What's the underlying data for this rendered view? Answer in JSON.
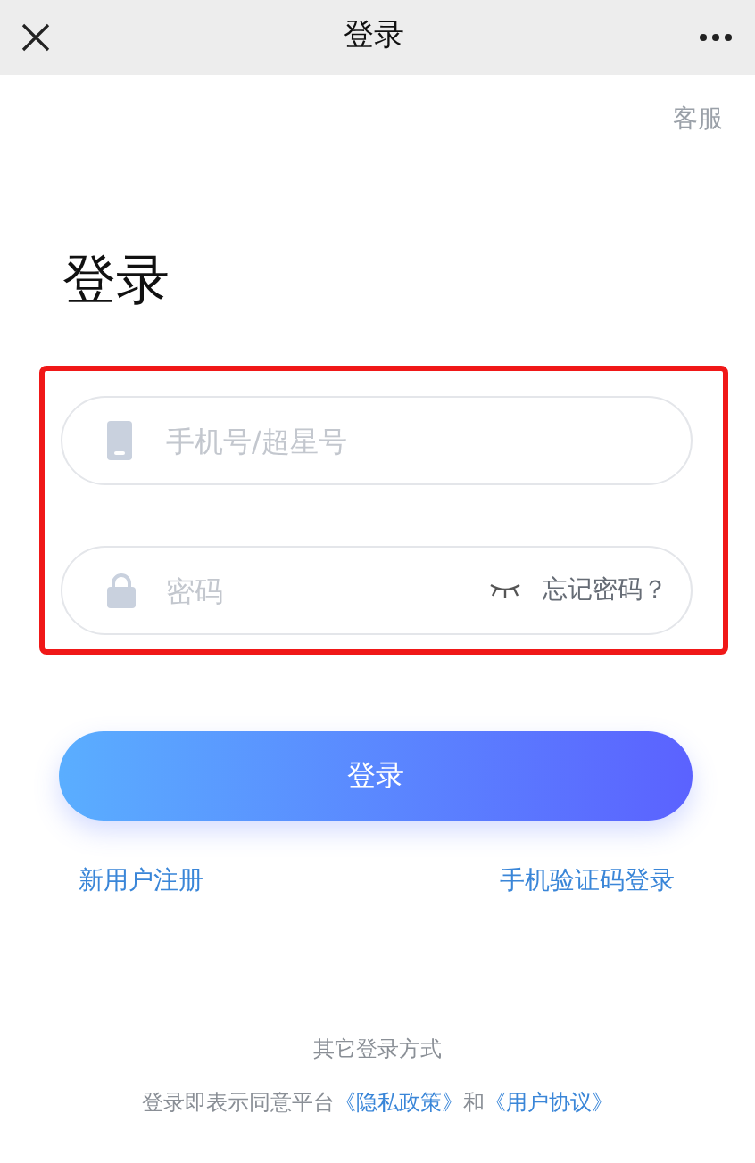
{
  "window": {
    "title": "登录"
  },
  "service_link": "客服",
  "heading": "登录",
  "fields": [
    {
      "kind": "phone",
      "placeholder": "手机号/超星号"
    },
    {
      "kind": "password",
      "placeholder": "密码",
      "action": "忘记密码？"
    }
  ],
  "login_button": "登录",
  "links": [
    "新用户注册",
    "手机验证码登录"
  ],
  "other_methods": "其它登录方式",
  "agreement": {
    "prefix": "登录即表示同意平台",
    "privacy": "《隐私政策》",
    "joiner": "和",
    "terms": "《用户协议》"
  }
}
